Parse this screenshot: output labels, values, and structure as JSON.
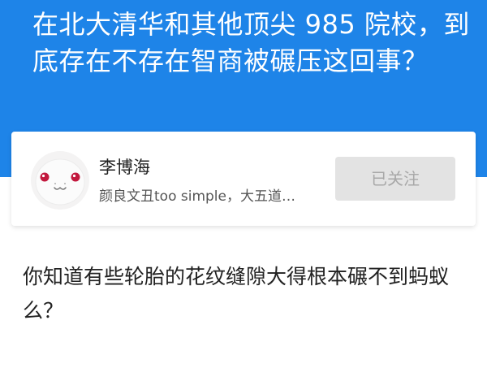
{
  "question": {
    "title": "在北大清华和其他顶尖 985 院校，到底存在不存在智商被碾压这回事？"
  },
  "author": {
    "name": "李博海",
    "bio": "颜良文丑too simple，大五道…",
    "avatar_icon": "white-mascot-avatar",
    "follow_button_label": "已关注"
  },
  "answer": {
    "text": "你知道有些轮胎的花纹缝隙大得根本碾不到蚂蚁么？"
  },
  "colors": {
    "header_bg": "#1e84e8",
    "button_bg": "#e3e3e3",
    "button_text": "#a8a8a8"
  }
}
